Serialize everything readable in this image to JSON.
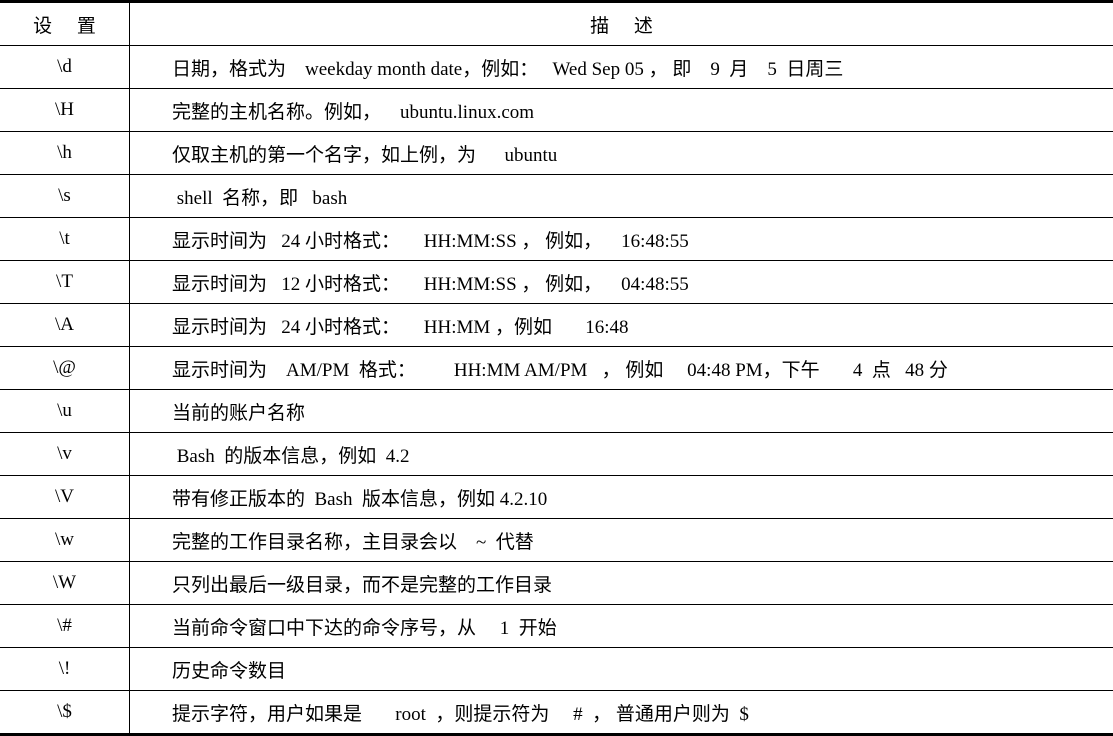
{
  "header": {
    "setting": "设 置",
    "description": "描 述"
  },
  "rows": [
    {
      "setting": "\\d",
      "description": "日期，格式为    weekday month date，例如：   Wed Sep 05 ， 即    9  月    5  日周三"
    },
    {
      "setting": "\\H",
      "description": "完整的主机名称。例如，    ubuntu.linux.com"
    },
    {
      "setting": "\\h",
      "description": "仅取主机的第一个名字，如上例，为      ubuntu"
    },
    {
      "setting": "\\s",
      "description": " shell  名称，即   bash"
    },
    {
      "setting": "\\t",
      "description": "显示时间为   24 小时格式：     HH:MM:SS ， 例如，    16:48:55"
    },
    {
      "setting": "\\T",
      "description": "显示时间为   12 小时格式：     HH:MM:SS ， 例如，    04:48:55"
    },
    {
      "setting": "\\A",
      "description": "显示时间为   24 小时格式：     HH:MM ，例如       16:48"
    },
    {
      "setting": "\\@",
      "description": "显示时间为    AM/PM  格式：        HH:MM AM/PM   ， 例如     04:48 PM，下午       4  点   48 分"
    },
    {
      "setting": "\\u",
      "description": "当前的账户名称"
    },
    {
      "setting": "\\v",
      "description": " Bash  的版本信息，例如  4.2"
    },
    {
      "setting": "\\V",
      "description": "带有修正版本的  Bash  版本信息，例如 4.2.10"
    },
    {
      "setting": "\\w",
      "description": "完整的工作目录名称，主目录会以    ~  代替"
    },
    {
      "setting": "\\W",
      "description": "只列出最后一级目录，而不是完整的工作目录"
    },
    {
      "setting": "\\#",
      "description": "当前命令窗口中下达的命令序号，从     1  开始"
    },
    {
      "setting": "\\!",
      "description": "历史命令数目"
    },
    {
      "setting": "\\$",
      "description": "提示字符，用户如果是       root  ，则提示符为     #  ， 普通用户则为  $"
    }
  ]
}
